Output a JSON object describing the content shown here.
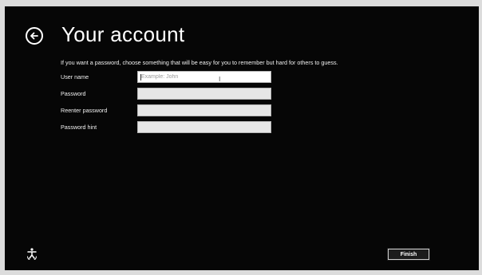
{
  "header": {
    "title": "Your account",
    "back_icon": "back-arrow-circle-icon"
  },
  "instructions": "If you want a password, choose something that will be easy for you to remember but hard for others to guess.",
  "form": {
    "fields": [
      {
        "label": "User name",
        "placeholder": "Example: John",
        "value": ""
      },
      {
        "label": "Password",
        "placeholder": "",
        "value": ""
      },
      {
        "label": "Reenter password",
        "placeholder": "",
        "value": ""
      },
      {
        "label": "Password hint",
        "placeholder": "",
        "value": ""
      }
    ]
  },
  "footer": {
    "ease_of_access_icon": "ease-of-access-icon",
    "finish_label": "Finish"
  },
  "colors": {
    "background": "#060606",
    "text": "#ffffff",
    "input_background": "#e6e6e6"
  }
}
